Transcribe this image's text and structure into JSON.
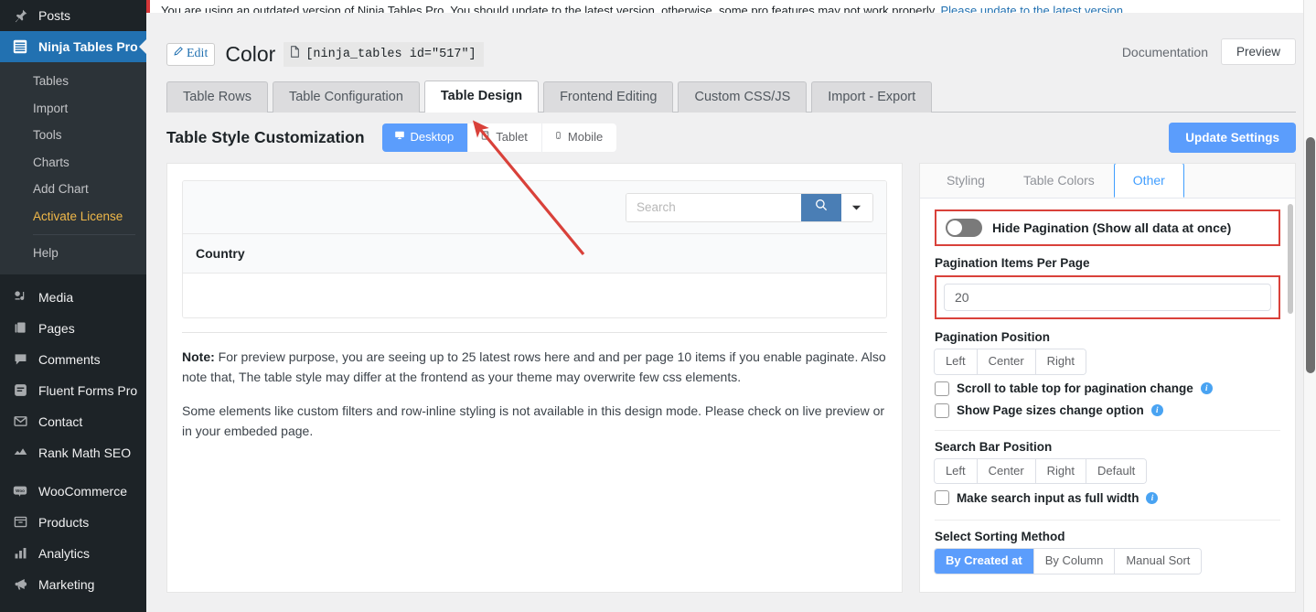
{
  "sidebar": {
    "top_items": [
      {
        "label": "Posts",
        "icon": "pin-icon",
        "name": "sidebar-item-posts"
      }
    ],
    "active_item": {
      "label": "Ninja Tables Pro",
      "icon": "table-stack-icon",
      "name": "sidebar-item-ninja-tables-pro"
    },
    "submenu": [
      {
        "label": "Tables",
        "name": "sidebar-subitem-tables"
      },
      {
        "label": "Import",
        "name": "sidebar-subitem-import"
      },
      {
        "label": "Tools",
        "name": "sidebar-subitem-tools"
      },
      {
        "label": "Charts",
        "name": "sidebar-subitem-charts"
      },
      {
        "label": "Add Chart",
        "name": "sidebar-subitem-add-chart"
      },
      {
        "label": "Activate License",
        "name": "sidebar-subitem-activate-license",
        "highlight": true
      }
    ],
    "submenu_after": [
      {
        "label": "Help",
        "name": "sidebar-subitem-help"
      }
    ],
    "bottom_items": [
      {
        "label": "Media",
        "icon": "media-icon",
        "name": "sidebar-item-media"
      },
      {
        "label": "Pages",
        "icon": "pages-icon",
        "name": "sidebar-item-pages"
      },
      {
        "label": "Comments",
        "icon": "comments-icon",
        "name": "sidebar-item-comments"
      },
      {
        "label": "Fluent Forms Pro",
        "icon": "form-icon",
        "name": "sidebar-item-fluent-forms-pro"
      },
      {
        "label": "Contact",
        "icon": "envelope-icon",
        "name": "sidebar-item-contact"
      },
      {
        "label": "Rank Math SEO",
        "icon": "rankmath-icon",
        "name": "sidebar-item-rank-math-seo"
      },
      {
        "label": "WooCommerce",
        "icon": "woocommerce-icon",
        "name": "sidebar-item-woocommerce"
      },
      {
        "label": "Products",
        "icon": "products-icon",
        "name": "sidebar-item-products"
      },
      {
        "label": "Analytics",
        "icon": "analytics-icon",
        "name": "sidebar-item-analytics"
      },
      {
        "label": "Marketing",
        "icon": "megaphone-icon",
        "name": "sidebar-item-marketing"
      }
    ]
  },
  "notice": {
    "text": "You are using an outdated version of Ninja Tables Pro. You should update to the latest version, otherwise, some pro features may not work properly. ",
    "link": "Please update to the latest version"
  },
  "header": {
    "edit_label": "Edit",
    "title": "Color",
    "shortcode": "[ninja_tables id=\"517\"]",
    "documentation_label": "Documentation",
    "preview_label": "Preview"
  },
  "tabs": [
    {
      "label": "Table Rows",
      "active": false
    },
    {
      "label": "Table Configuration",
      "active": false
    },
    {
      "label": "Table Design",
      "active": true
    },
    {
      "label": "Frontend Editing",
      "active": false
    },
    {
      "label": "Custom CSS/JS",
      "active": false
    },
    {
      "label": "Import - Export",
      "active": false
    }
  ],
  "style_row": {
    "title": "Table Style Customization",
    "devices": [
      {
        "label": "Desktop",
        "icon": "desktop-icon",
        "active": true
      },
      {
        "label": "Tablet",
        "icon": "tablet-icon",
        "active": false
      },
      {
        "label": "Mobile",
        "icon": "mobile-icon",
        "active": false
      }
    ],
    "update_label": "Update Settings"
  },
  "preview": {
    "search_placeholder": "Search",
    "search_value": "",
    "column_header": "Country",
    "note_prefix": "Note:",
    "note_text": " For preview purpose, you are seeing up to 25 latest rows here and and per page 10 items if you enable paginate. Also note that, The table style may differ at the frontend as your theme may overwrite few css elements.",
    "note_second": "Some elements like custom filters and row-inline styling is not available in this design mode. Please check on live preview or in your embeded page."
  },
  "settings": {
    "tabs": [
      {
        "label": "Styling",
        "active": false
      },
      {
        "label": "Table Colors",
        "active": false
      },
      {
        "label": "Other",
        "active": true
      }
    ],
    "hide_pagination_label": "Hide Pagination (Show all data at once)",
    "hide_pagination_on": false,
    "items_per_page_label": "Pagination Items Per Page",
    "items_per_page_value": "20",
    "pagination_position_label": "Pagination Position",
    "pagination_position_options": [
      {
        "label": "Left",
        "active": false
      },
      {
        "label": "Center",
        "active": false
      },
      {
        "label": "Right",
        "active": false
      }
    ],
    "scroll_top_label": "Scroll to table top for pagination change",
    "scroll_top_checked": false,
    "page_sizes_label": "Show Page sizes change option",
    "page_sizes_checked": false,
    "search_bar_position_label": "Search Bar Position",
    "search_bar_position_options": [
      {
        "label": "Left",
        "active": false
      },
      {
        "label": "Center",
        "active": false
      },
      {
        "label": "Right",
        "active": false
      },
      {
        "label": "Default",
        "active": false
      }
    ],
    "full_width_label": "Make search input as full width",
    "full_width_checked": false,
    "sorting_method_label": "Select Sorting Method",
    "sorting_method_options": [
      {
        "label": "By Created at",
        "active": true
      },
      {
        "label": "By Column",
        "active": false
      },
      {
        "label": "Manual Sort",
        "active": false
      }
    ]
  },
  "colors": {
    "accent_blue": "#5b9dfc",
    "wp_blue": "#2271b1",
    "sidebar_dark": "#1d2327",
    "annotation_red": "#d9413a",
    "license_orange": "#f0b849"
  }
}
